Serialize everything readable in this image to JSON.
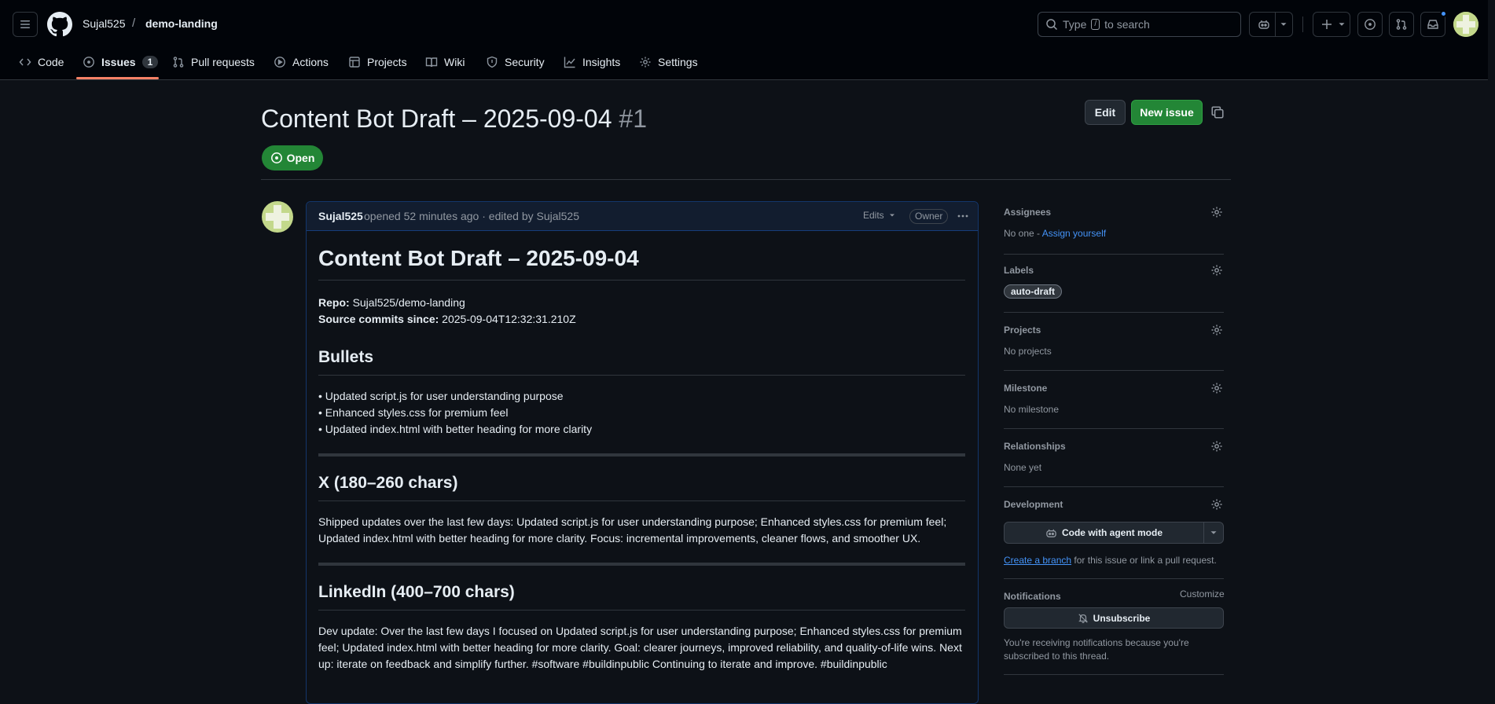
{
  "header": {
    "owner": "Sujal525",
    "separator": "/",
    "repo": "demo-landing",
    "search_prefix": "Type",
    "search_key": "/",
    "search_suffix": "to search"
  },
  "nav": {
    "tabs": [
      {
        "label": "Code"
      },
      {
        "label": "Issues",
        "count": "1"
      },
      {
        "label": "Pull requests"
      },
      {
        "label": "Actions"
      },
      {
        "label": "Projects"
      },
      {
        "label": "Wiki"
      },
      {
        "label": "Security"
      },
      {
        "label": "Insights"
      },
      {
        "label": "Settings"
      }
    ]
  },
  "issue": {
    "title": "Content Bot Draft – 2025-09-04",
    "number": "#1",
    "state": "Open",
    "edit_label": "Edit",
    "new_issue_label": "New issue"
  },
  "comment": {
    "author": "Sujal525",
    "meta": "opened 52 minutes ago · edited by Sujal525",
    "edits_label": "Edits",
    "owner_badge": "Owner",
    "body": {
      "h1": "Content Bot Draft – 2025-09-04",
      "repo_label": "Repo:",
      "repo_value": "Sujal525/demo-landing",
      "commits_label": "Source commits since:",
      "commits_value": "2025-09-04T12:32:31.210Z",
      "bullets_heading": "Bullets",
      "bullets": [
        "• Updated script.js for user understanding purpose",
        "• Enhanced styles.css for premium feel",
        "• Updated index.html with better heading for more clarity"
      ],
      "x_heading": "X (180–260 chars)",
      "x_text": "Shipped updates over the last few days: Updated script.js for user understanding purpose; Enhanced styles.css for premium feel; Updated index.html with better heading for more clarity. Focus: incremental improvements, cleaner flows, and smoother UX.",
      "linkedin_heading": "LinkedIn (400–700 chars)",
      "linkedin_text": "Dev update: Over the last few days I focused on Updated script.js for user understanding purpose; Enhanced styles.css for premium feel; Updated index.html with better heading for more clarity. Goal: clearer journeys, improved reliability, and quality-of-life wins. Next up: iterate on feedback and simplify further. #software #buildinpublic Continuing to iterate and improve. #buildinpublic"
    }
  },
  "sidebar": {
    "assignees_title": "Assignees",
    "assignees_none": "No one -",
    "assign_yourself": "Assign yourself",
    "labels_title": "Labels",
    "label_chip": "auto-draft",
    "projects_title": "Projects",
    "projects_none": "No projects",
    "milestone_title": "Milestone",
    "milestone_none": "No milestone",
    "relationships_title": "Relationships",
    "relationships_none": "None yet",
    "development_title": "Development",
    "agent_button": "Code with agent mode",
    "create_branch": "Create a branch",
    "branch_suffix": "for this issue or link a pull request.",
    "notifications_title": "Notifications",
    "customize": "Customize",
    "unsubscribe": "Unsubscribe",
    "notify_text": "You're receiving notifications because you're subscribed to this thread."
  },
  "colors": {
    "bg": "#0d1117",
    "header_bg": "#010409",
    "accent_green": "#238636",
    "link": "#4493f8",
    "tab_underline": "#f78166"
  }
}
